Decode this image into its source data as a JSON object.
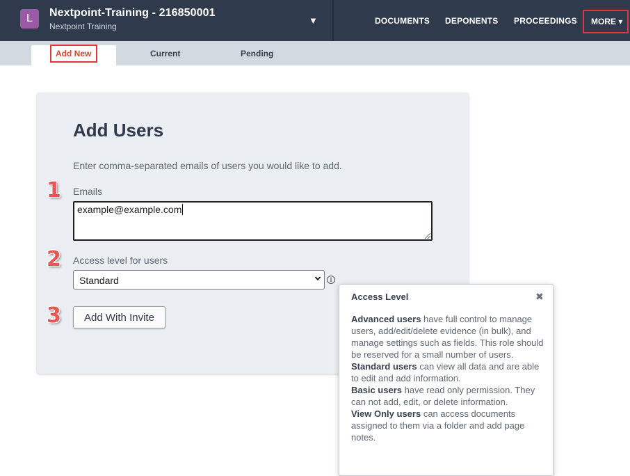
{
  "header": {
    "case_initial": "L",
    "case_title": "Nextpoint-Training - 216850001",
    "case_subtitle": "Nextpoint Training",
    "case_caret": "▼",
    "nav": {
      "documents": "DOCUMENTS",
      "deponents": "DEPONENTS",
      "proceedings": "PROCEEDINGS",
      "more": "MORE ▾"
    }
  },
  "tabs": {
    "add_new": "Add New",
    "current": "Current",
    "pending": "Pending"
  },
  "form": {
    "title": "Add Users",
    "description": "Enter comma-separated emails of users you would like to add.",
    "emails_label": "Emails",
    "emails_value": "example@example.com",
    "access_label": "Access level for users",
    "access_selected": "Standard",
    "info_glyph": "i",
    "invite_button": "Add With Invite"
  },
  "steps": {
    "s1": "1",
    "s2": "2",
    "s3": "3"
  },
  "popover": {
    "title": "Access Level",
    "close": "✖",
    "advanced_name": "Advanced users",
    "advanced_text": " have full control to manage users, add/edit/delete evidence (in bulk), and manage settings such as fields. This role should be reserved for a small number of users.",
    "standard_name": "Standard users",
    "standard_text": " can view all data and are able to edit and add information.",
    "basic_name": "Basic users",
    "basic_text": " have read only permission. They can not add, edit, or delete information.",
    "viewonly_name": "View Only users",
    "viewonly_text": " can access documents assigned to them via a folder and add page notes."
  },
  "colors": {
    "topbar": "#2f3a4c",
    "badge": "#9c59a6",
    "highlight": "#e2363c",
    "tabbar": "#d2d9e0",
    "card": "#ebeff3"
  }
}
